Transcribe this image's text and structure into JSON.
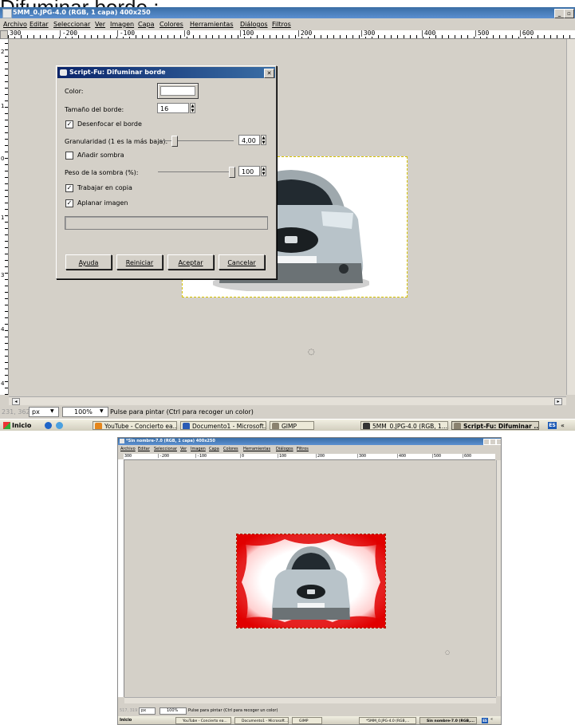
{
  "caption": "Difuminar  borde :",
  "screenshot1": {
    "window_title": "5MM_0.JPG-4.0 (RGB, 1 capa) 400x250",
    "menu": [
      "Archivo",
      "Editar",
      "Seleccionar",
      "Ver",
      "Imagen",
      "Capa",
      "Colores",
      "Herramientas",
      "Diálogos",
      "Filtros"
    ],
    "ruler_labels": [
      "300",
      "|-200",
      "|-100",
      "|0",
      "|100",
      "|200",
      "|300",
      "|400",
      "|500",
      "|600"
    ],
    "vruler_labels": [
      "2",
      "1",
      "0",
      "1",
      "3",
      "4",
      "4"
    ],
    "status": {
      "coords": "231, 362",
      "unit": "px",
      "zoom": "100%",
      "message": "Pulse para pintar (Ctrl para recoger un color)"
    },
    "taskbar": {
      "start": "Inicio",
      "items": [
        "YouTube - Concierto ea...",
        "Documento1 - Microsoft...",
        "GIMP",
        "5MM_0.JPG-4.0 (RGB, 1...",
        "Script-Fu: Difuminar ..."
      ],
      "lang": "ES",
      "more": "«"
    },
    "dialog": {
      "title": "Script-Fu: Difuminar borde",
      "color_label": "Color:",
      "size_label": "Tamaño del borde:",
      "size_value": "16",
      "blur_label": "Desenfocar el borde",
      "blur_checked": "✓",
      "granularity_label": "Granularidad (1 es la más baja):",
      "granularity_value": "4,00",
      "shadow_label": "Añadir sombra",
      "shadow_weight_label": "Peso de la sombra (%):",
      "shadow_weight_value": "100",
      "copy_label": "Trabajar en copia",
      "copy_checked": "✓",
      "flatten_label": "Aplanar imagen",
      "flatten_checked": "✓",
      "buttons": {
        "help": "Ayuda",
        "reset": "Reiniciar",
        "ok": "Aceptar",
        "cancel": "Cancelar"
      }
    }
  },
  "screenshot2": {
    "window_title": "*Sin nombre-7.0 (RGB, 1 capa) 400x250",
    "menu": [
      "Archivo",
      "Editar",
      "Seleccionar",
      "Ver",
      "Imagen",
      "Capa",
      "Colores",
      "Herramientas",
      "Diálogos",
      "Filtros"
    ],
    "ruler_labels": [
      "300",
      "|-200",
      "|-100",
      "|0",
      "|100",
      "|200",
      "|300",
      "|400",
      "|500",
      "|600"
    ],
    "status": {
      "coords": "517, 319",
      "unit": "px",
      "zoom": "100%",
      "message": "Pulse para pintar (Ctrl para recoger un color)"
    },
    "taskbar": {
      "start": "Inicio",
      "items": [
        "YouTube - Concierto ea...",
        "Documento1 - Microsoft...",
        "GIMP",
        "*5MM_0.JPG-4.0 (RGB,...",
        "Sin nombre-7.0 (RGB,..."
      ],
      "lang": "ES",
      "more": "«"
    }
  },
  "colors": {
    "titlebar": "#3a6ea5",
    "dialog_bg": "#d4d0c8",
    "border_red": "#e00000"
  }
}
